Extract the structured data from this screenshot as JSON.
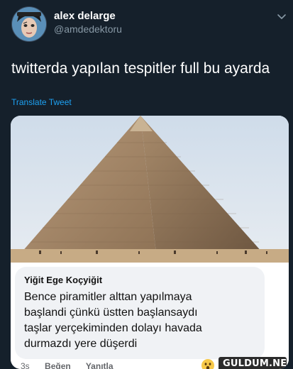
{
  "author": {
    "name": "alex delarge",
    "handle": "@amdedektoru"
  },
  "tweet": {
    "text": "twitterda yapılan tespitler full bu ayarda",
    "translate_label": "Translate Tweet"
  },
  "comment": {
    "commenter": "Yiğit Ege Koçyiğit",
    "lines": [
      "Bence piramitler alttan yapılmaya",
      "başlandi çünkü üstten başlansaydı",
      "taşlar yerçekiminden dolayı havada",
      "durmazdı yere düşerdi"
    ],
    "time": "3s",
    "like_label": "Beğen",
    "reply_label": "Yanıtla"
  },
  "watermark": "GULDUM.NET",
  "colors": {
    "background": "#15202b",
    "link": "#1da1f2",
    "secondary_text": "#8899a6"
  }
}
